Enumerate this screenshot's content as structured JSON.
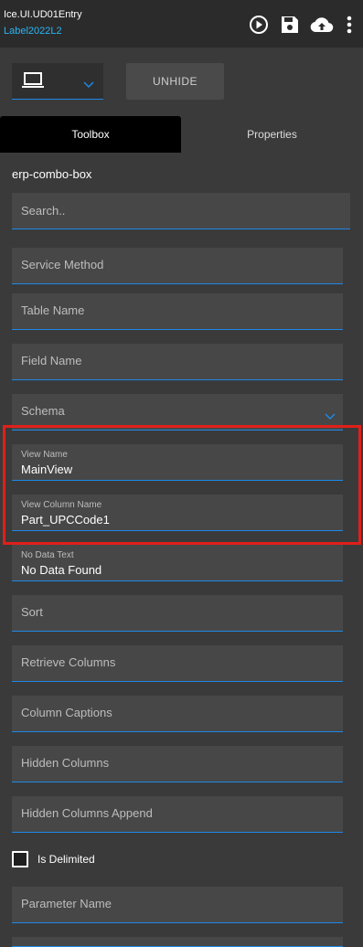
{
  "header": {
    "title": "Ice.UI.UD01Entry",
    "subtitle": "Label2022L2",
    "icons": [
      "play-circle-icon",
      "save-icon",
      "cloud-upload-icon",
      "more-vert-icon"
    ]
  },
  "toolbar": {
    "device_icon": "laptop-icon",
    "unhide_label": "UNHIDE"
  },
  "tabs": [
    {
      "label": "Toolbox",
      "active": true
    },
    {
      "label": "Properties",
      "active": false
    }
  ],
  "component_name": "erp-combo-box",
  "search": {
    "placeholder": "Search.."
  },
  "properties": {
    "service_method": {
      "placeholder": "Service Method"
    },
    "table_name": {
      "placeholder": "Table Name"
    },
    "field_name": {
      "placeholder": "Field Name"
    },
    "schema": {
      "placeholder": "Schema"
    },
    "view_name": {
      "label": "View Name",
      "value": "MainView"
    },
    "view_column_name": {
      "label": "View Column Name",
      "value": "Part_UPCCode1"
    },
    "no_data_text": {
      "label": "No Data Text",
      "value": "No Data Found"
    },
    "sort": {
      "placeholder": "Sort"
    },
    "retrieve_columns": {
      "placeholder": "Retrieve Columns"
    },
    "column_captions": {
      "placeholder": "Column Captions"
    },
    "hidden_columns": {
      "placeholder": "Hidden Columns"
    },
    "hidden_columns_append": {
      "placeholder": "Hidden Columns Append"
    },
    "is_delimited": {
      "label": "Is Delimited",
      "checked": false
    },
    "parameter_name": {
      "placeholder": "Parameter Name"
    }
  },
  "colors": {
    "accent": "#1e88e5",
    "subtitle": "#29b6f6",
    "highlight": "#e0201b"
  }
}
